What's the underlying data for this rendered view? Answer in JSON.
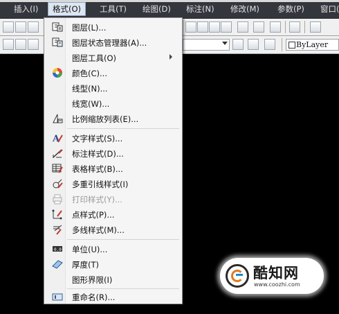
{
  "menubar": {
    "items": [
      {
        "label": "插入(I)"
      },
      {
        "label": "格式(O)"
      },
      {
        "label": "工具(T)"
      },
      {
        "label": "绘图(D)"
      },
      {
        "label": "标注(N)"
      },
      {
        "label": "修改(M)"
      },
      {
        "label": "参数(P)"
      },
      {
        "label": "窗口("
      }
    ]
  },
  "toolbar": {
    "color_combo": "ByLayer"
  },
  "format_menu": {
    "items": [
      {
        "label": "图层(L)...",
        "icon": "layer-icon"
      },
      {
        "label": "图层状态管理器(A)...",
        "icon": "layer-state-icon"
      },
      {
        "label": "图层工具(O)",
        "submenu": true
      },
      {
        "label": "颜色(C)...",
        "icon": "color-wheel-icon"
      },
      {
        "label": "线型(N)..."
      },
      {
        "label": "线宽(W)..."
      },
      {
        "label": "比例缩放列表(E)...",
        "icon": "scale-list-icon"
      },
      {
        "label": "文字样式(S)...",
        "icon": "text-style-icon"
      },
      {
        "label": "标注样式(D)...",
        "icon": "dimension-style-icon"
      },
      {
        "label": "表格样式(B)...",
        "icon": "table-style-icon"
      },
      {
        "label": "多重引线样式(I)",
        "icon": "multileader-style-icon"
      },
      {
        "label": "打印样式(Y)...",
        "icon": "plot-style-icon",
        "disabled": true
      },
      {
        "label": "点样式(P)...",
        "icon": "point-style-icon"
      },
      {
        "label": "多线样式(M)...",
        "icon": "multiline-style-icon"
      },
      {
        "label": "单位(U)...",
        "icon": "units-icon"
      },
      {
        "label": "厚度(T)",
        "icon": "thickness-icon"
      },
      {
        "label": "图形界限(I)"
      },
      {
        "label": "重命名(R)...",
        "icon": "rename-icon"
      }
    ]
  },
  "watermark": {
    "name": "酷知网",
    "url": "www.coozhi.com"
  }
}
